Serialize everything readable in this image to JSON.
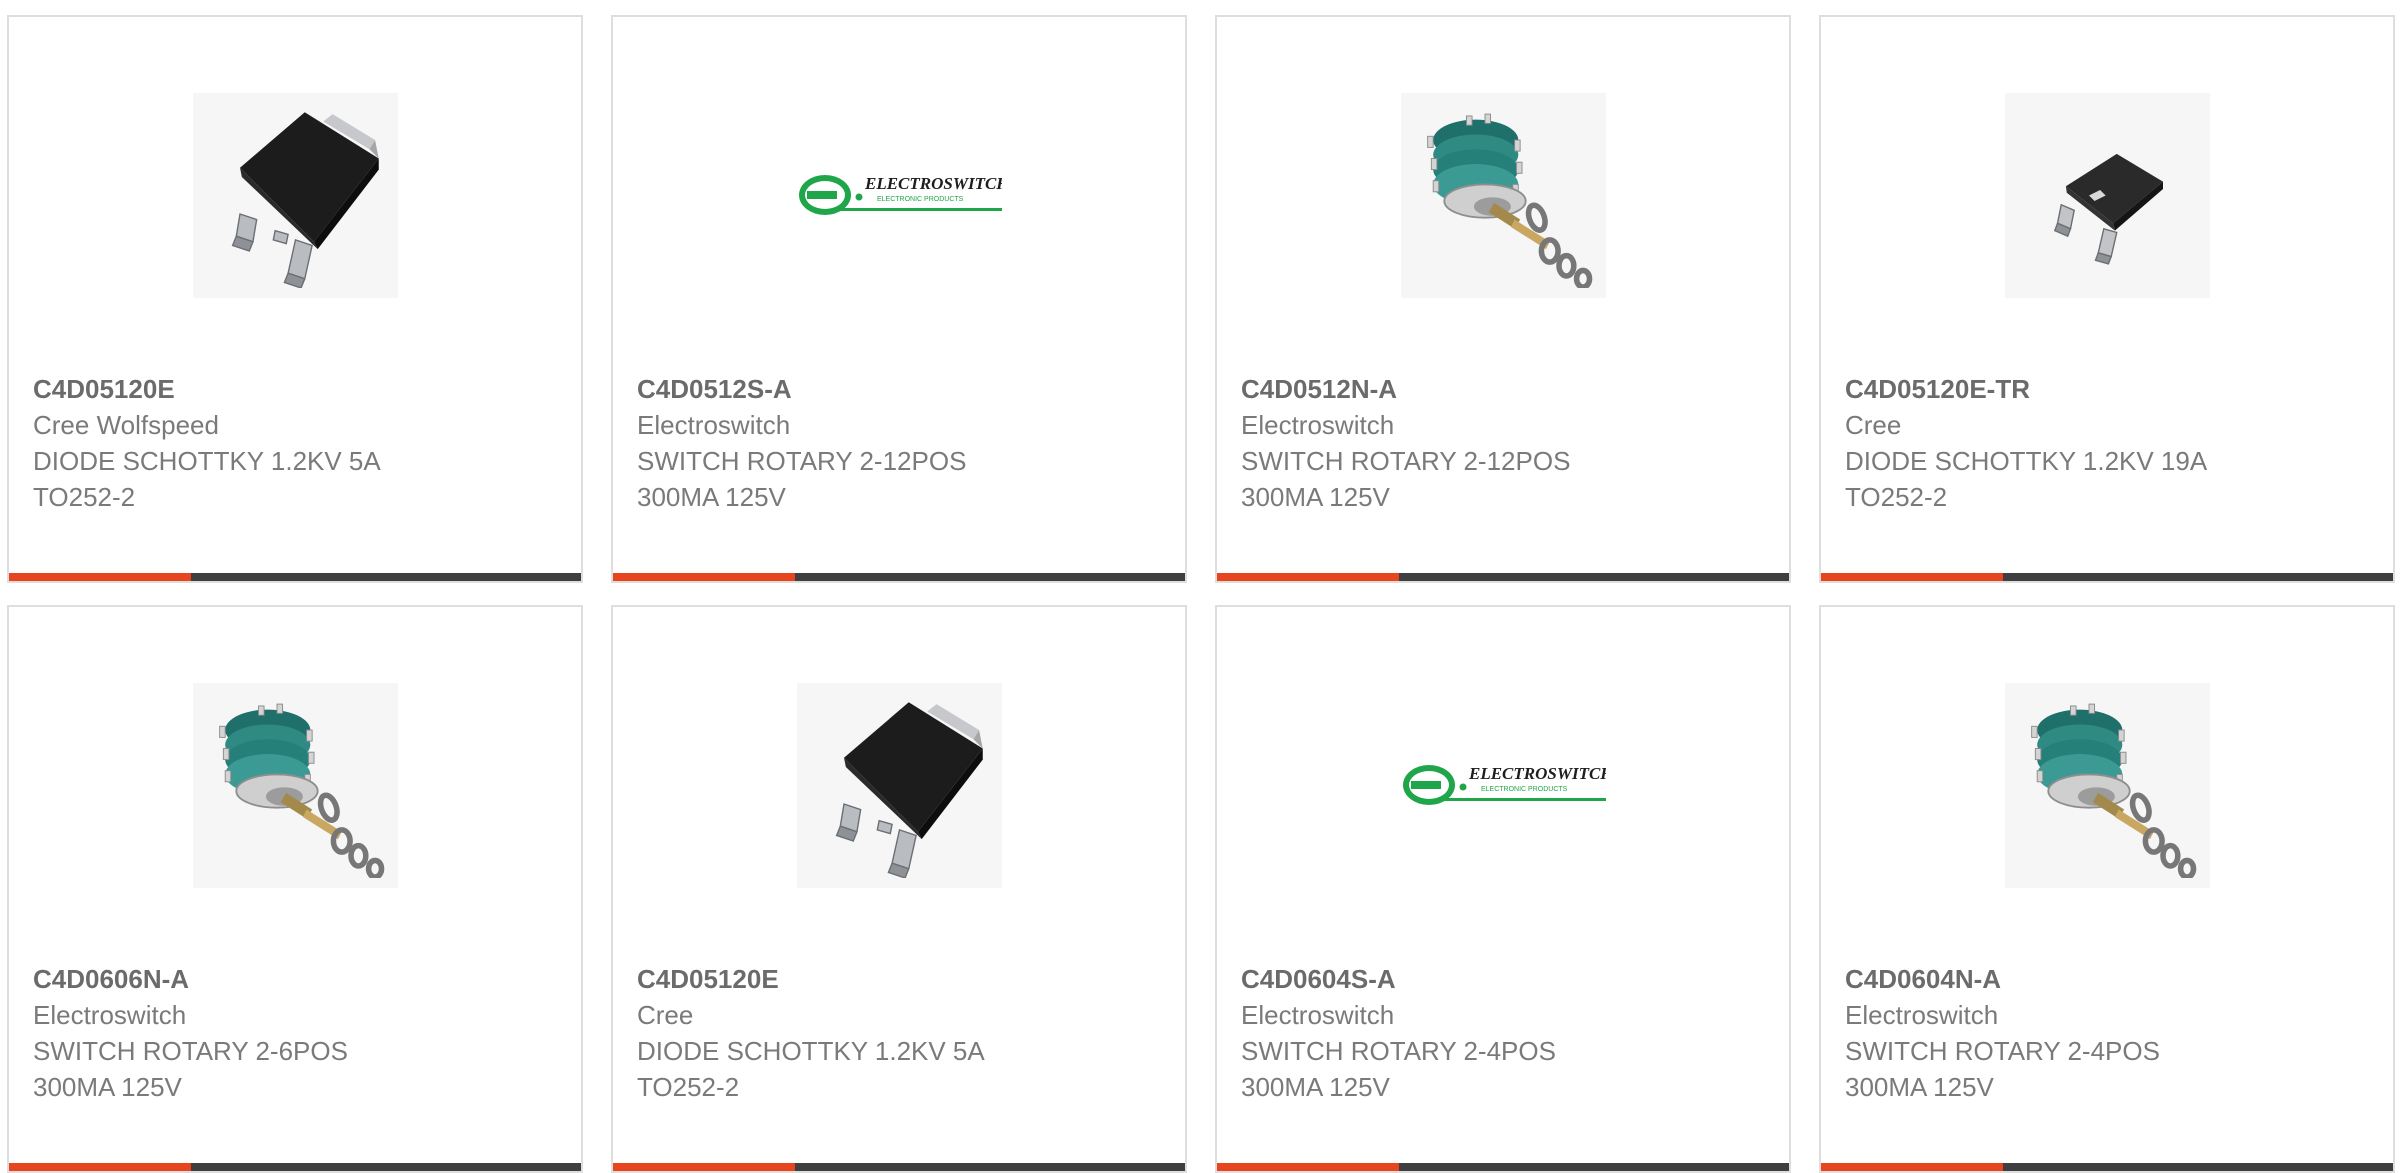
{
  "colors": {
    "accent": "#e8441d",
    "bar": "#3f3f3f",
    "border": "#dedede",
    "text": "#7a7a7a"
  },
  "cards": [
    {
      "part_number": "C4D05120E",
      "manufacturer": "Cree Wolfspeed",
      "desc_line1": "DIODE SCHOTTKY 1.2KV 5A",
      "desc_line2": "TO252-2",
      "image": "to252-package"
    },
    {
      "part_number": "C4D0512S-A",
      "manufacturer": "Electroswitch",
      "desc_line1": "SWITCH ROTARY 2-12POS",
      "desc_line2": "300MA 125V",
      "image": "electroswitch-logo",
      "logo_text": "ELECTROSWITCH",
      "logo_subtext": "ELECTRONIC PRODUCTS"
    },
    {
      "part_number": "C4D0512N-A",
      "manufacturer": "Electroswitch",
      "desc_line1": "SWITCH ROTARY 2-12POS",
      "desc_line2": "300MA 125V",
      "image": "rotary-switch"
    },
    {
      "part_number": "C4D05120E-TR",
      "manufacturer": "Cree",
      "desc_line1": "DIODE SCHOTTKY 1.2KV 19A",
      "desc_line2": "TO252-2",
      "image": "to252-small-package"
    },
    {
      "part_number": "C4D0606N-A",
      "manufacturer": "Electroswitch",
      "desc_line1": "SWITCH ROTARY 2-6POS",
      "desc_line2": "300MA 125V",
      "image": "rotary-switch"
    },
    {
      "part_number": "C4D05120E",
      "manufacturer": "Cree",
      "desc_line1": "DIODE SCHOTTKY 1.2KV 5A",
      "desc_line2": "TO252-2",
      "image": "to252-package"
    },
    {
      "part_number": "C4D0604S-A",
      "manufacturer": "Electroswitch",
      "desc_line1": "SWITCH ROTARY 2-4POS",
      "desc_line2": "300MA 125V",
      "image": "electroswitch-logo",
      "logo_text": "ELECTROSWITCH",
      "logo_subtext": "ELECTRONIC PRODUCTS"
    },
    {
      "part_number": "C4D0604N-A",
      "manufacturer": "Electroswitch",
      "desc_line1": "SWITCH ROTARY 2-4POS",
      "desc_line2": "300MA 125V",
      "image": "rotary-switch"
    }
  ]
}
